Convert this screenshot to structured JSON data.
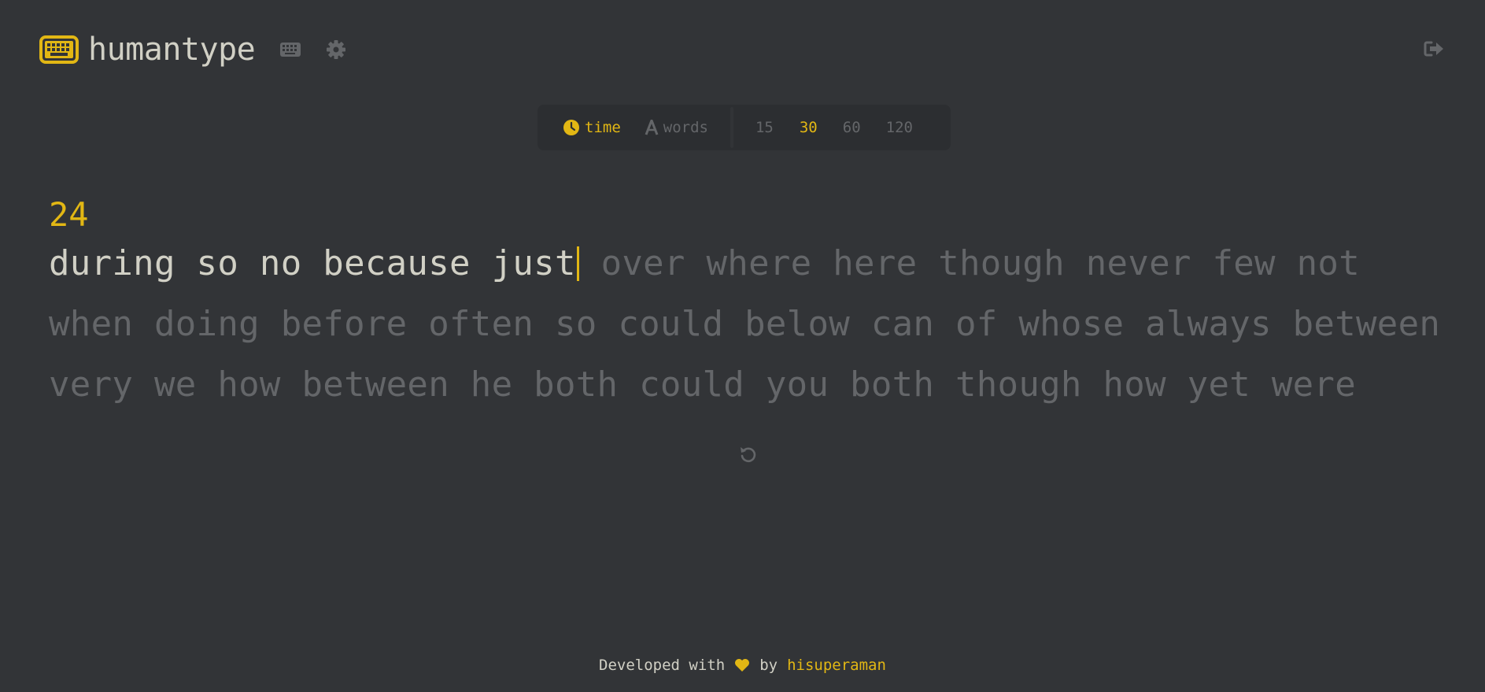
{
  "app": {
    "title": "humantype",
    "icons": {
      "logo": "keyboard-icon",
      "keyboard_button": "keyboard-icon",
      "settings_button": "gear-icon",
      "logout_button": "sign-out-icon",
      "restart_button": "restart-icon"
    }
  },
  "colors": {
    "background": "#323437",
    "accent": "#e2b714",
    "text_typed": "#d1d0c5",
    "text_untyped": "#646669",
    "panel": "#2c2e31"
  },
  "mode_bar": {
    "modes": [
      {
        "label": "time",
        "icon": "clock-icon",
        "active": true
      },
      {
        "label": "words",
        "icon": "letter-a-icon",
        "active": false
      }
    ],
    "durations": [
      {
        "label": "15",
        "active": false
      },
      {
        "label": "30",
        "active": true
      },
      {
        "label": "60",
        "active": false
      },
      {
        "label": "120",
        "active": false
      }
    ]
  },
  "test": {
    "timer": "24",
    "typed_text": "during so no because just",
    "lines": [
      "over where here though never few not",
      "when doing before often so could below can of whose always between",
      "very we how between he both could you both though how yet were"
    ]
  },
  "footer": {
    "prefix": "Developed with",
    "middle": "by",
    "author": "hisuperaman"
  }
}
